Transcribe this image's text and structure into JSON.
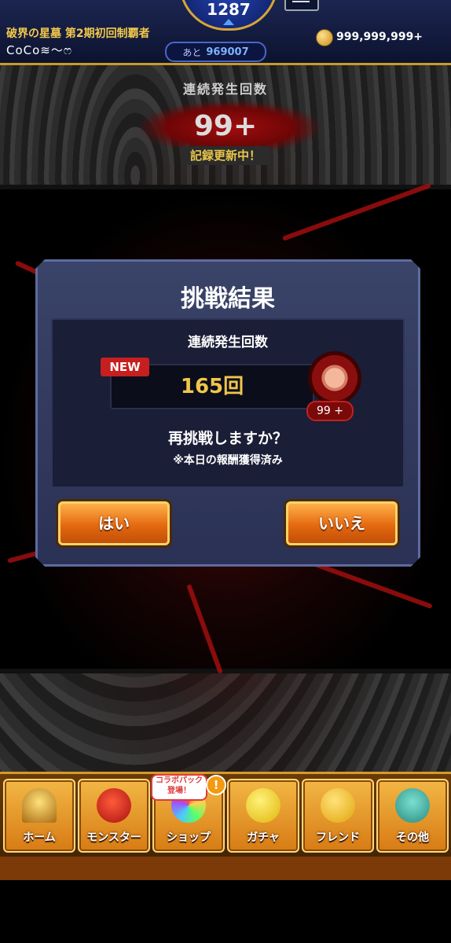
{
  "header": {
    "level": "1287",
    "rank_title": "破界の星墓 第2期初回制覇者",
    "player_name": "CoCo≋〜ෆ",
    "exp_label": "あと",
    "exp_value": "969007",
    "coins": "999,999,999+"
  },
  "stage": {
    "streak_label": "連続発生回数",
    "streak_count": "99+",
    "record_label": "記録更新中！"
  },
  "dialog": {
    "title": "挑戦結果",
    "streak_label": "連続発生回数",
    "new_badge": "NEW",
    "count": "165回",
    "fist_badge": "99 +",
    "retry_question": "再挑戦しますか？",
    "reward_note": "※本日の報酬獲得済み",
    "yes_label": "はい",
    "no_label": "いいえ"
  },
  "nav": {
    "items": [
      {
        "label": "ホーム",
        "icon": "home-gate-icon"
      },
      {
        "label": "モンスター",
        "icon": "red-dragon-icon"
      },
      {
        "label": "ショップ",
        "icon": "rainbow-orb-icon"
      },
      {
        "label": "ガチャ",
        "icon": "egg-icon"
      },
      {
        "label": "フレンド",
        "icon": "balloons-icon"
      },
      {
        "label": "その他",
        "icon": "question-icon"
      }
    ],
    "collab_badge": "コラボパック\n登場！",
    "alert": "!"
  },
  "colors": {
    "accent_gold": "#f0c64a",
    "button_orange": "#e46a10",
    "dialog_bg": "#2a3155",
    "new_badge_red": "#c51f1f"
  }
}
